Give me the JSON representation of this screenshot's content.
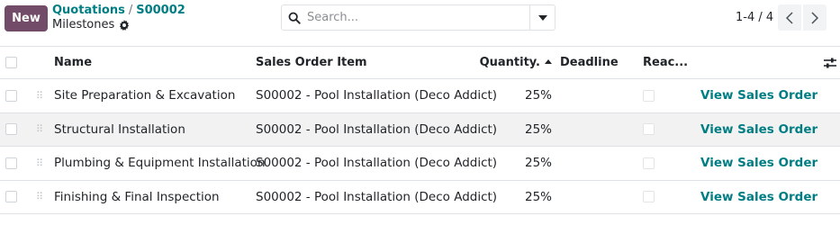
{
  "control_panel": {
    "new_button": "New",
    "breadcrumb": {
      "parent": "Quotations",
      "separator": "/",
      "record": "S00002",
      "current": "Milestones"
    },
    "search": {
      "placeholder": "Search..."
    },
    "pager": {
      "text": "1-4 / 4"
    }
  },
  "table": {
    "columns": {
      "name": "Name",
      "sales_order_item": "Sales Order Item",
      "quantity": "Quantity.",
      "deadline": "Deadline",
      "reached": "Reac..."
    },
    "rows": [
      {
        "name": "Site Preparation & Excavation",
        "sales_order_item": "S00002 - Pool Installation (Deco Addict)",
        "quantity": "25%",
        "deadline": "",
        "reached": false,
        "action": "View Sales Order"
      },
      {
        "name": "Structural Installation",
        "sales_order_item": "S00002 - Pool Installation (Deco Addict)",
        "quantity": "25%",
        "deadline": "",
        "reached": false,
        "action": "View Sales Order"
      },
      {
        "name": "Plumbing & Equipment Installation",
        "sales_order_item": "S00002 - Pool Installation (Deco Addict)",
        "quantity": "25%",
        "deadline": "",
        "reached": false,
        "action": "View Sales Order"
      },
      {
        "name": "Finishing & Final Inspection",
        "sales_order_item": "S00002 - Pool Installation (Deco Addict)",
        "quantity": "25%",
        "deadline": "",
        "reached": false,
        "action": "View Sales Order"
      }
    ],
    "sort": {
      "column": "quantity",
      "direction": "ascending"
    }
  },
  "icons": {
    "gear": "gear-icon",
    "search": "search-icon",
    "dropdown": "caret-down-icon",
    "prev": "chevron-left-icon",
    "next": "chevron-right-icon",
    "optional_columns": "sliders-icon",
    "drag_handle": "drag-handle-icon"
  },
  "colors": {
    "brand": "#714B67",
    "link": "#017e84",
    "border": "#dee2e6",
    "row_highlight": "#f2f2f2"
  }
}
